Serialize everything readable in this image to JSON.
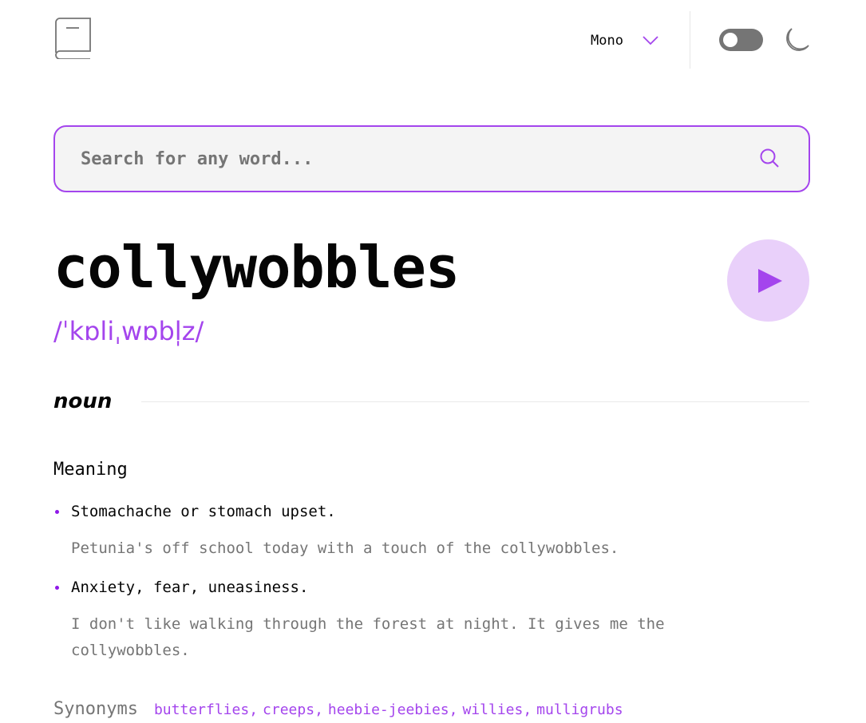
{
  "header": {
    "logo_icon": "book-icon",
    "font_selector": {
      "value": "Mono",
      "icon": "chevron-down-icon"
    },
    "theme_toggle": {
      "state": "off"
    },
    "theme_icon": "moon-icon"
  },
  "search": {
    "placeholder": "Search for any word...",
    "value": "",
    "icon": "search-icon"
  },
  "entry": {
    "word": "collywobbles",
    "phonetic": "/ˈkɒliˌwɒbl̩z/",
    "play_icon": "play-icon",
    "part_of_speech": "noun",
    "meaning_label": "Meaning",
    "definitions": [
      {
        "text": "Stomachache or stomach upset.",
        "example": "Petunia's off school today with a touch of the collywobbles."
      },
      {
        "text": "Anxiety, fear, uneasiness.",
        "example": "I don't like walking through the forest at night. It gives me the collywobbles."
      }
    ],
    "synonyms_label": "Synonyms",
    "synonyms": [
      "butterflies",
      "creeps",
      "heebie-jeebies",
      "willies",
      "mulligrubs"
    ]
  },
  "colors": {
    "accent": "#a445ed",
    "accent_light": "#e9d0fa",
    "text": "#050505",
    "muted": "#757575",
    "search_bg": "#f4f4f4"
  }
}
